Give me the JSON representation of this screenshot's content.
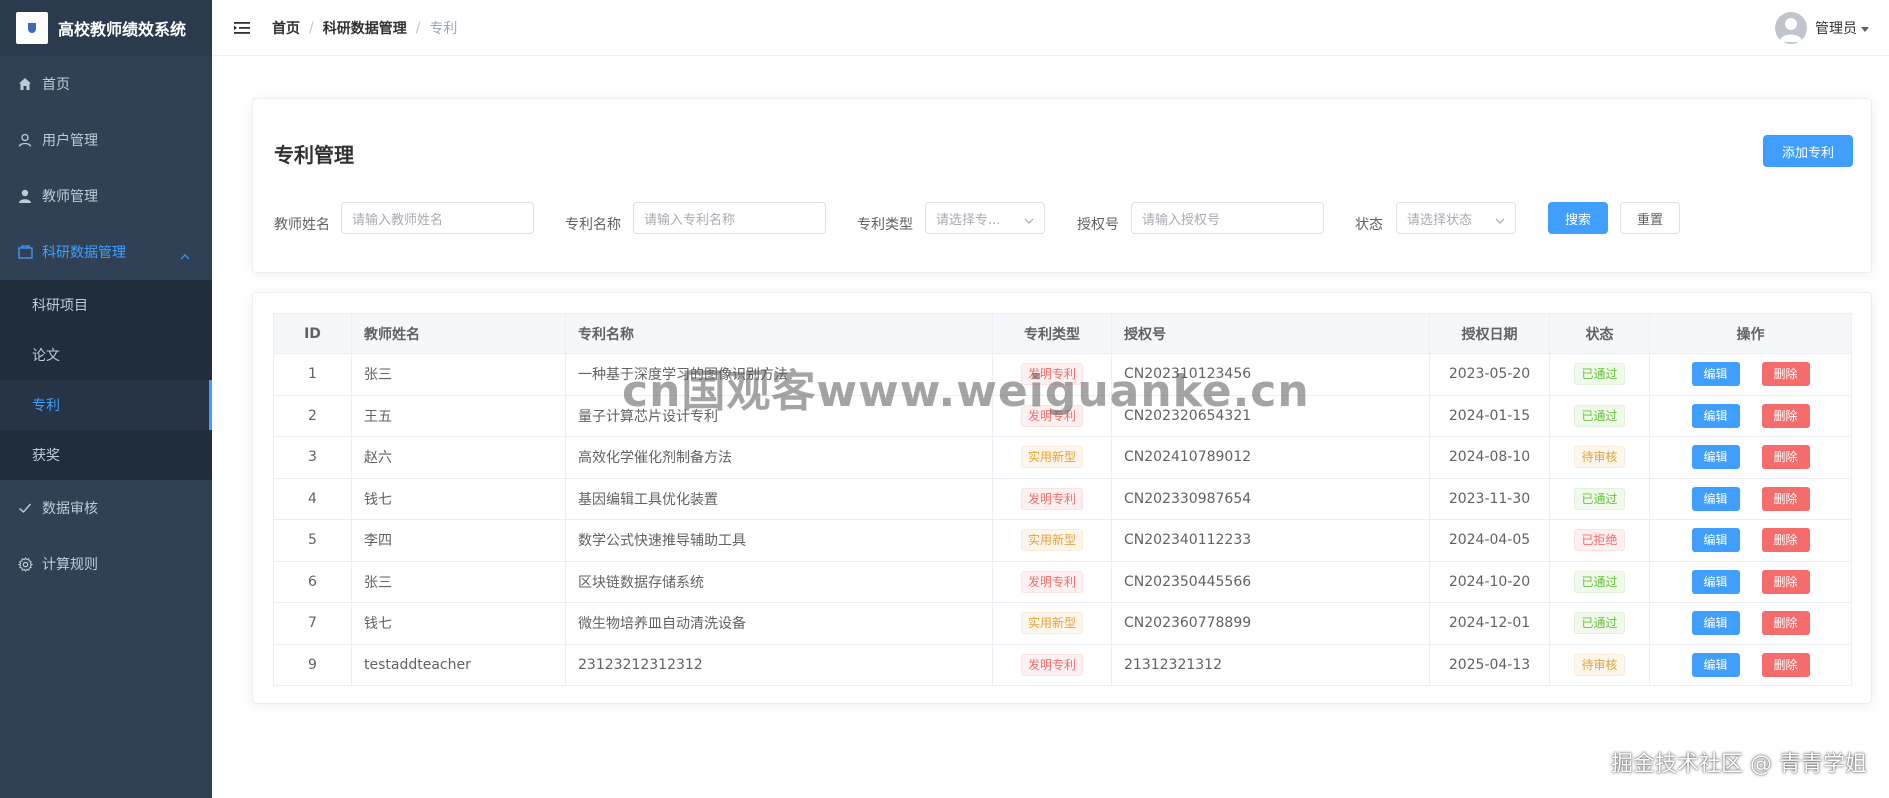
{
  "app": {
    "title": "高校教师绩效系统"
  },
  "sidebar": {
    "items": [
      {
        "label": "首页",
        "icon": "home-icon"
      },
      {
        "label": "用户管理",
        "icon": "user-icon"
      },
      {
        "label": "教师管理",
        "icon": "teacher-icon"
      },
      {
        "label": "科研数据管理",
        "icon": "folder-icon",
        "expanded": true,
        "children": [
          {
            "label": "科研项目"
          },
          {
            "label": "论文"
          },
          {
            "label": "专利",
            "active": true
          },
          {
            "label": "获奖"
          }
        ]
      },
      {
        "label": "数据审核",
        "icon": "check-icon"
      },
      {
        "label": "计算规则",
        "icon": "gear-icon"
      }
    ]
  },
  "header": {
    "breadcrumb": [
      "首页",
      "科研数据管理",
      "专利"
    ],
    "user_name": "管理员"
  },
  "search": {
    "title": "专利管理",
    "add_label": "添加专利",
    "fields": [
      {
        "label": "教师姓名",
        "placeholder": "请输入教师姓名"
      },
      {
        "label": "专利名称",
        "placeholder": "请输入专利名称"
      },
      {
        "label": "专利类型",
        "placeholder": "请选择专..."
      },
      {
        "label": "授权号",
        "placeholder": "请输入授权号"
      },
      {
        "label": "状态",
        "placeholder": "请选择状态"
      }
    ],
    "search_label": "搜索",
    "reset_label": "重置"
  },
  "table": {
    "columns": [
      "ID",
      "教师姓名",
      "专利名称",
      "专利类型",
      "授权号",
      "授权日期",
      "状态",
      "操作"
    ],
    "edit_label": "编辑",
    "delete_label": "删除",
    "rows": [
      {
        "id": "1",
        "teacher": "张三",
        "name": "一种基于深度学习的图像识别方法",
        "type": "发明专利",
        "type_tag": "danger",
        "number": "CN202310123456",
        "date": "2023-05-20",
        "status": "已通过",
        "status_tag": "success"
      },
      {
        "id": "2",
        "teacher": "王五",
        "name": "量子计算芯片设计专利",
        "type": "发明专利",
        "type_tag": "danger",
        "number": "CN202320654321",
        "date": "2024-01-15",
        "status": "已通过",
        "status_tag": "success"
      },
      {
        "id": "3",
        "teacher": "赵六",
        "name": "高效化学催化剂制备方法",
        "type": "实用新型",
        "type_tag": "warning",
        "number": "CN202410789012",
        "date": "2024-08-10",
        "status": "待审核",
        "status_tag": "warning"
      },
      {
        "id": "4",
        "teacher": "钱七",
        "name": "基因编辑工具优化装置",
        "type": "发明专利",
        "type_tag": "danger",
        "number": "CN202330987654",
        "date": "2023-11-30",
        "status": "已通过",
        "status_tag": "success"
      },
      {
        "id": "5",
        "teacher": "李四",
        "name": "数学公式快速推导辅助工具",
        "type": "实用新型",
        "type_tag": "warning",
        "number": "CN202340112233",
        "date": "2024-04-05",
        "status": "已拒绝",
        "status_tag": "danger"
      },
      {
        "id": "6",
        "teacher": "张三",
        "name": "区块链数据存储系统",
        "type": "发明专利",
        "type_tag": "danger",
        "number": "CN202350445566",
        "date": "2024-10-20",
        "status": "已通过",
        "status_tag": "success"
      },
      {
        "id": "7",
        "teacher": "钱七",
        "name": "微生物培养皿自动清洗设备",
        "type": "实用新型",
        "type_tag": "warning",
        "number": "CN202360778899",
        "date": "2024-12-01",
        "status": "已通过",
        "status_tag": "success"
      },
      {
        "id": "9",
        "teacher": "testaddteacher",
        "name": "23123212312312",
        "type": "发明专利",
        "type_tag": "danger",
        "number": "21312321312",
        "date": "2025-04-13",
        "status": "待审核",
        "status_tag": "warning"
      }
    ]
  },
  "watermark": "cn国观客www.weiguanke.cn",
  "footer_brand": "掘金技术社区 @ 青青学姐",
  "colors": {
    "primary": "#409eff",
    "danger": "#f56c6c",
    "warning": "#e6a23c",
    "success": "#67c23a",
    "sidebar_bg": "#304156"
  }
}
